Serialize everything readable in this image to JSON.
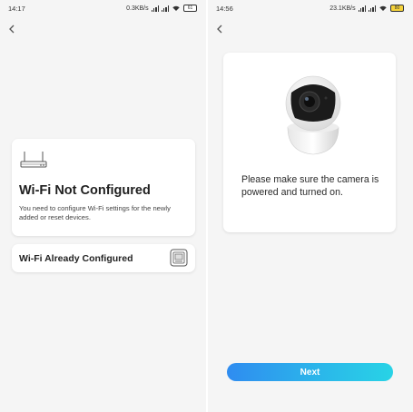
{
  "left_screen": {
    "status": {
      "time": "14:17",
      "speed": "0.3KB/s",
      "battery": "61"
    },
    "not_configured_card": {
      "title": "Wi-Fi Not Configured",
      "description": "You need to configure Wi-Fi settings for the newly added or reset devices."
    },
    "configured_card": {
      "label": "Wi-Fi Already Configured"
    }
  },
  "right_screen": {
    "status": {
      "time": "14:56",
      "speed": "23.1KB/s",
      "battery": "80"
    },
    "camera_card": {
      "message": "Please make sure the camera is powered and turned on."
    },
    "next_label": "Next"
  },
  "colors": {
    "accent_start": "#2f8cf0",
    "accent_end": "#28d3e6",
    "card_bg": "#ffffff"
  },
  "icons": [
    "back-icon",
    "router-icon",
    "qr-scan-icon",
    "camera-image",
    "signal-icon",
    "wifi-icon",
    "battery-icon"
  ]
}
